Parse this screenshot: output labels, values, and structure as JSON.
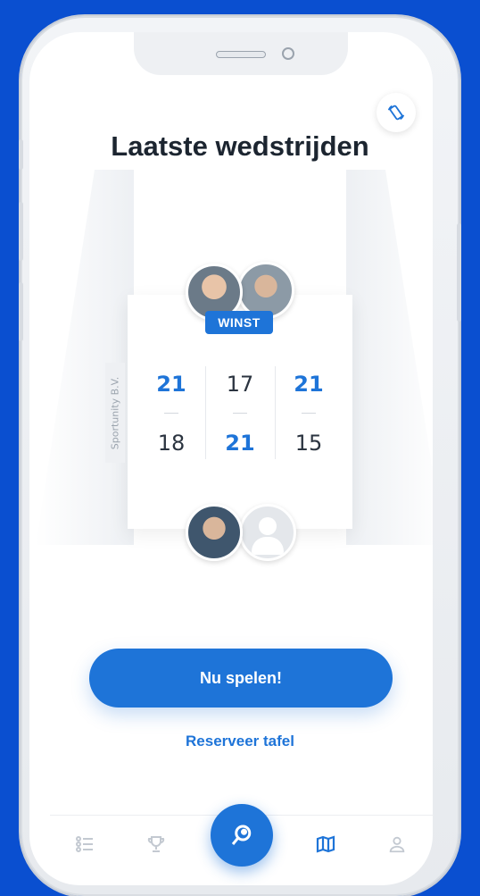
{
  "screen": {
    "title": "Laatste wedstrijden",
    "rotate_icon": "rotate-device-icon"
  },
  "match": {
    "side_label": "Sportunity B.V.",
    "result_badge": "WINST",
    "sets": [
      {
        "top": "21",
        "bottom": "18",
        "winner": "top"
      },
      {
        "top": "17",
        "bottom": "21",
        "winner": "bottom"
      },
      {
        "top": "21",
        "bottom": "15",
        "winner": "top"
      }
    ]
  },
  "actions": {
    "play_label": "Nu spelen!",
    "reserve_label": "Reserveer tafel"
  },
  "tabbar": {
    "items": [
      {
        "icon": "list-icon"
      },
      {
        "icon": "trophy-icon"
      },
      {
        "icon": "search-ping-pong-icon"
      },
      {
        "icon": "map-icon"
      },
      {
        "icon": "profile-icon"
      }
    ]
  },
  "colors": {
    "accent": "#1e74d8",
    "background": "#0a4fd0"
  }
}
